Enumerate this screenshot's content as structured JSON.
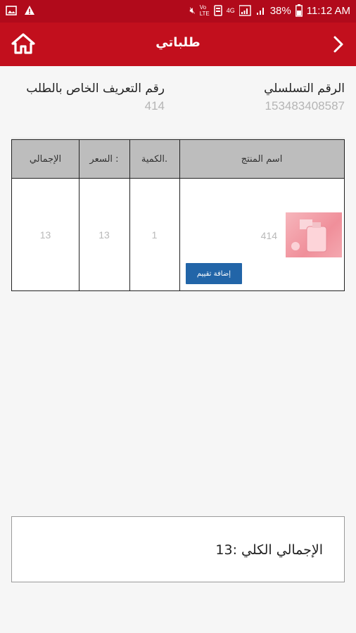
{
  "status_bar": {
    "battery_percent": "38%",
    "time": "11:12 AM",
    "network": "4G",
    "carrier_tag": "Vo LTE"
  },
  "app_bar": {
    "title": "طلباتي",
    "accent_color": "#c20f1d"
  },
  "order": {
    "serial_label": "الرقم التسلسلي",
    "serial_value": "153483408587",
    "id_label": "رقم التعريف الخاص بالطلب",
    "id_value": "414"
  },
  "table": {
    "headers": {
      "product": "اسم المنتج",
      "quantity": "الكمية.",
      "price": "السعر :",
      "total": "الإجمالي"
    },
    "rows": [
      {
        "product_name": "414",
        "quantity": "1",
        "price": "13",
        "total": "13",
        "rate_button": "إضافة تقييم"
      }
    ]
  },
  "summary": {
    "grand_total": "الإجمالي الكلي :13"
  }
}
